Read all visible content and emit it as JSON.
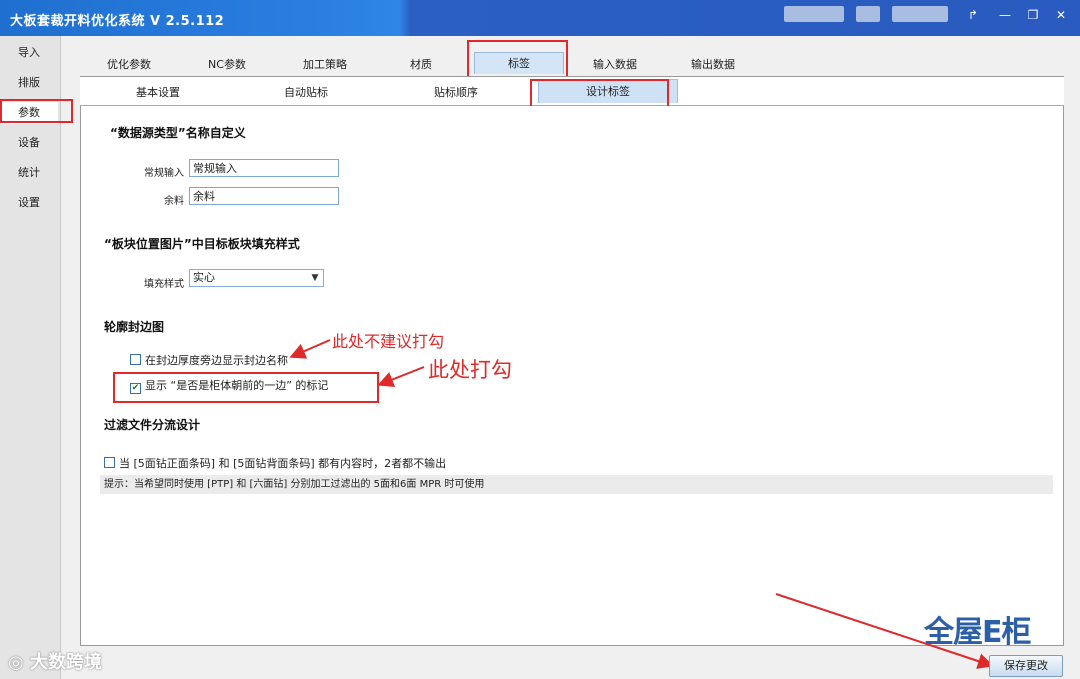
{
  "window": {
    "title": "大板套裁开料优化系统 V 2.5.112",
    "controls": [
      "↱",
      "—",
      "❐",
      "✕"
    ]
  },
  "sidebar": {
    "items": [
      {
        "label": "导入"
      },
      {
        "label": "排版"
      },
      {
        "label": "参数"
      },
      {
        "label": "设备"
      },
      {
        "label": "统计"
      },
      {
        "label": "设置"
      }
    ]
  },
  "tabs_main": [
    "优化参数",
    "NC参数",
    "加工策略",
    "材质",
    "标签",
    "输入数据",
    "输出数据"
  ],
  "tabs_sub": [
    "基本设置",
    "自动贴标",
    "贴标顺序",
    "设计标签"
  ],
  "sections": {
    "datasource": {
      "title": "“数据源类型”名称自定义",
      "normal_label": "常规输入",
      "normal_value": "常规输入",
      "remnant_label": "余料",
      "remnant_value": "余料"
    },
    "fill": {
      "title": "“板块位置图片”中目标板块填充样式",
      "label": "填充样式",
      "value": "实心"
    },
    "edge": {
      "title": "轮廓封边图",
      "opt1": "在封边厚度旁边显示封边名称",
      "opt2": "显示 “是否是柜体朝前的一边” 的标记"
    },
    "filter": {
      "title": "过滤文件分流设计",
      "opt": "当 [5面钻正面条码] 和 [5面钻背面条码] 都有内容时，2者都不输出",
      "hint": "提示：当希望同时使用 [PTP] 和 [六面钻] 分别加工过滤出的 5面和6面 MPR 时可使用"
    }
  },
  "annotations": {
    "not_recommended": "此处不建议打勾",
    "check_here": "此处打勾"
  },
  "buttons": {
    "save": "保存更改"
  },
  "watermarks": {
    "left": "大数跨境",
    "right": "全屋E柜"
  },
  "colors": {
    "accent": "#2a7fe0",
    "annotation": "#e0292a"
  }
}
